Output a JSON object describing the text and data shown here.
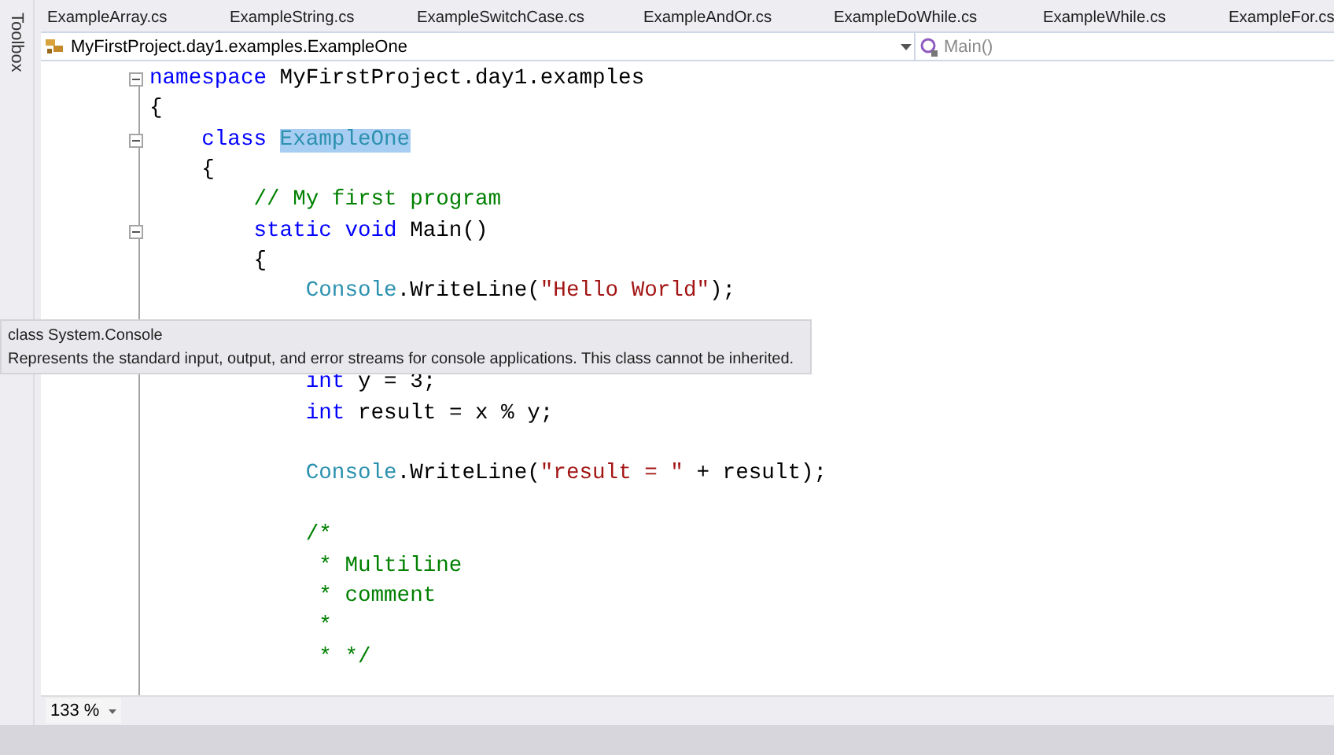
{
  "toolbox": {
    "label": "Toolbox"
  },
  "tabs": [
    {
      "label": "ExampleArray.cs"
    },
    {
      "label": "ExampleString.cs"
    },
    {
      "label": "ExampleSwitchCase.cs"
    },
    {
      "label": "ExampleAndOr.cs"
    },
    {
      "label": "ExampleDoWhile.cs"
    },
    {
      "label": "ExampleWhile.cs"
    },
    {
      "label": "ExampleFor.cs"
    }
  ],
  "navigation_bar": {
    "type_dropdown": "MyFirstProject.day1.examples.ExampleOne",
    "member_dropdown": "Main()"
  },
  "code_lines": [
    {
      "kind": "code",
      "fold": true,
      "tokens": [
        {
          "kind": "keyword",
          "text": "namespace"
        },
        {
          "kind": "plain",
          "text": " MyFirstProject.day1.examples"
        }
      ]
    },
    {
      "kind": "code",
      "fold": false,
      "tokens": [
        {
          "kind": "plain",
          "text": "{"
        }
      ]
    },
    {
      "kind": "code",
      "fold": true,
      "tokens": [
        {
          "kind": "keyword",
          "text": "    class "
        },
        {
          "kind": "type",
          "text": "ExampleOne",
          "selected": true
        }
      ]
    },
    {
      "kind": "code",
      "fold": false,
      "tokens": [
        {
          "kind": "plain",
          "text": "    {"
        }
      ]
    },
    {
      "kind": "code",
      "fold": false,
      "tokens": [
        {
          "kind": "comment",
          "text": "        // My first program"
        }
      ]
    },
    {
      "kind": "code",
      "fold": true,
      "tokens": [
        {
          "kind": "keyword",
          "text": "        static void"
        },
        {
          "kind": "plain",
          "text": " Main()"
        }
      ]
    },
    {
      "kind": "code",
      "fold": false,
      "tokens": [
        {
          "kind": "plain",
          "text": "        {"
        }
      ]
    },
    {
      "kind": "code",
      "fold": false,
      "tokens": [
        {
          "kind": "type",
          "text": "            Console",
          "selected": false
        },
        {
          "kind": "plain",
          "text": ".WriteLine("
        },
        {
          "kind": "string",
          "text": "\"Hello World\""
        },
        {
          "kind": "plain",
          "text": ");"
        }
      ]
    },
    {
      "kind": "blank"
    },
    {
      "kind": "blank"
    },
    {
      "kind": "code",
      "fold": false,
      "tokens": [
        {
          "kind": "keyword",
          "text": "            int"
        },
        {
          "kind": "plain",
          "text": " y = 3;"
        }
      ]
    },
    {
      "kind": "code",
      "fold": false,
      "tokens": [
        {
          "kind": "keyword",
          "text": "            int"
        },
        {
          "kind": "plain",
          "text": " result = x % y;"
        }
      ]
    },
    {
      "kind": "blank"
    },
    {
      "kind": "code",
      "fold": false,
      "tokens": [
        {
          "kind": "type",
          "text": "            Console",
          "selected": false
        },
        {
          "kind": "plain",
          "text": ".WriteLine("
        },
        {
          "kind": "string",
          "text": "\"result = \""
        },
        {
          "kind": "plain",
          "text": " + result);"
        }
      ]
    },
    {
      "kind": "blank"
    },
    {
      "kind": "code",
      "fold": false,
      "tokens": [
        {
          "kind": "comment",
          "text": "            /*"
        }
      ]
    },
    {
      "kind": "code",
      "fold": false,
      "tokens": [
        {
          "kind": "comment",
          "text": "             * Multiline"
        }
      ]
    },
    {
      "kind": "code",
      "fold": false,
      "tokens": [
        {
          "kind": "comment",
          "text": "             * comment"
        }
      ]
    },
    {
      "kind": "code",
      "fold": false,
      "tokens": [
        {
          "kind": "comment",
          "text": "             *"
        }
      ]
    },
    {
      "kind": "code",
      "fold": false,
      "tokens": [
        {
          "kind": "comment",
          "text": "             * */"
        }
      ]
    }
  ],
  "tooltip": {
    "signature": "class System.Console",
    "description": "Represents the standard input, output, and error streams for console applications. This class cannot be inherited."
  },
  "status_bar": {
    "zoom": "133 %"
  }
}
